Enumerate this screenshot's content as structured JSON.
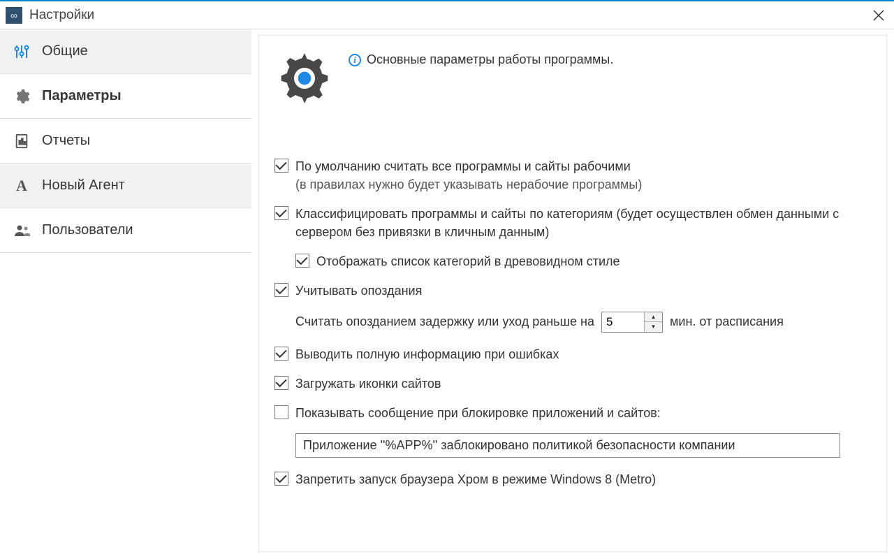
{
  "window": {
    "title": "Настройки"
  },
  "sidebar": {
    "items": [
      {
        "label": "Общие",
        "active": false
      },
      {
        "label": "Параметры",
        "active": true
      },
      {
        "label": "Отчеты",
        "active": false
      },
      {
        "label": "Новый Агент",
        "active": false
      },
      {
        "label": "Пользователи",
        "active": false
      }
    ]
  },
  "main": {
    "header_info": "Основные параметры работы программы.",
    "options": {
      "default_work": {
        "label": "По умолчанию считать все программы и сайты рабочими",
        "sub": "(в правилах нужно будет указывать нерабочие программы)",
        "checked": true
      },
      "classify": {
        "label": "Классифицировать программы и сайты по категориям (будет осуществлен обмен данными с сервером без привязки в кличным данным)",
        "checked": true
      },
      "tree_style": {
        "label": "Отображать список категорий в древовидном стиле",
        "checked": true
      },
      "lateness": {
        "label": "Учитывать опоздания",
        "checked": true
      },
      "lateness_row": {
        "prefix": "Считать опозданием задержку или уход раньше на",
        "value": "5",
        "suffix": "мин. от расписания"
      },
      "full_errors": {
        "label": "Выводить полную информацию при ошибках",
        "checked": true
      },
      "site_icons": {
        "label": "Загружать иконки сайтов",
        "checked": true
      },
      "block_msg": {
        "label": "Показывать сообщение при блокировке приложений и сайтов:",
        "checked": false,
        "text": "Приложение ''%APP%'' заблокировано политикой безопасности компании"
      },
      "chrome_metro": {
        "label": "Запретить запуск браузера Хром в режиме Windows 8 (Metro)",
        "checked": true
      }
    }
  }
}
